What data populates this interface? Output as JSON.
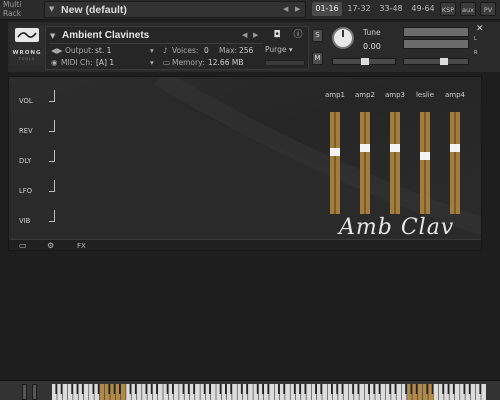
{
  "topbar": {
    "rack_label_1": "Multi",
    "rack_label_2": "Rack",
    "preset_name": "New (default)",
    "page_tabs": [
      "01-16",
      "17-32",
      "33-48",
      "49-64"
    ],
    "active_tab_index": 0,
    "ksp_label": "KSP",
    "aux_label": "aux"
  },
  "instrument": {
    "name": "Ambient Clavinets",
    "output_label": "Output:",
    "output_value": "st. 1",
    "midi_label": "MIDI Ch:",
    "midi_value": "[A]  1",
    "voices_label": "Voices:",
    "voices_value": "0",
    "max_label": "Max:",
    "max_value": "256",
    "memory_label": "Memory:",
    "memory_value": "12.66 MB",
    "purge_label": "Purge",
    "solo_label": "S",
    "mute_label": "M",
    "tune_label": "Tune",
    "tune_value": "0.00",
    "l_label": "L",
    "r_label": "R",
    "pv_label": "PV"
  },
  "logo": {
    "text": "WRONG",
    "sub": "TOOLS"
  },
  "effects": {
    "labels": [
      "VOL",
      "REV",
      "DLY",
      "LFO",
      "VIB"
    ]
  },
  "amps": {
    "labels": [
      "amp1",
      "amp2",
      "amp3",
      "leslie",
      "amp4"
    ],
    "levels": [
      0.62,
      0.66,
      0.66,
      0.57,
      0.66
    ],
    "slider_color": "#a27d3e"
  },
  "panel": {
    "script_title": "Amb Clav",
    "footer_fx_label": "FX"
  }
}
